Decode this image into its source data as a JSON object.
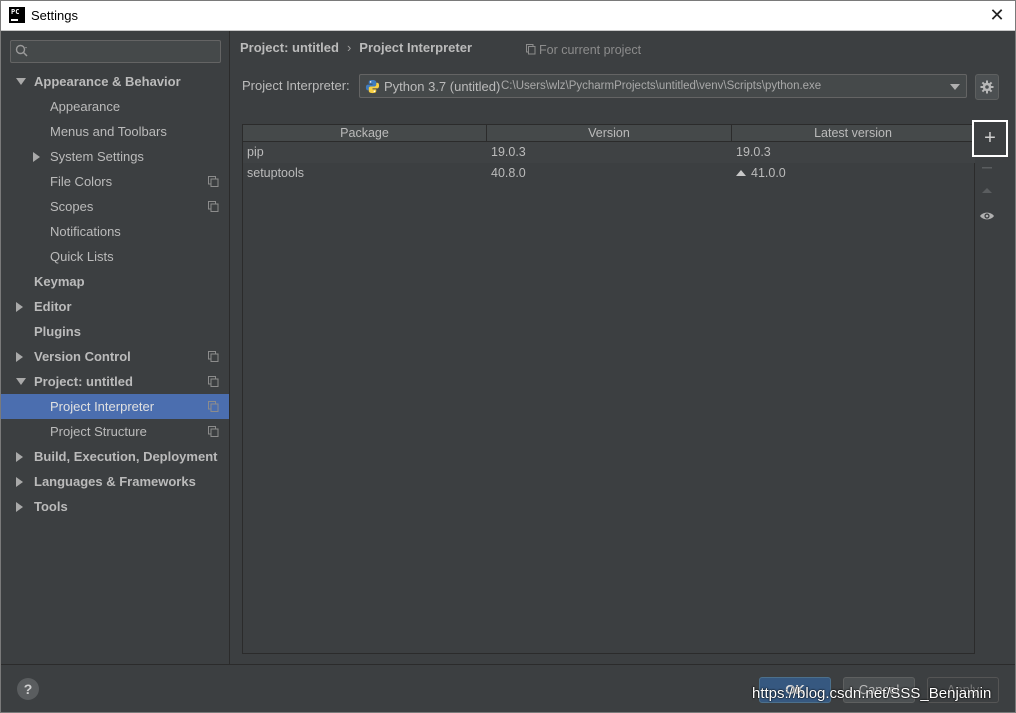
{
  "window": {
    "title": "Settings",
    "app_logo_text": "PC"
  },
  "search": {
    "placeholder": "",
    "value": ""
  },
  "sidebar": {
    "items": [
      {
        "label": "Appearance & Behavior",
        "level": 0,
        "bold": true,
        "arrow": "down",
        "project_icon": false,
        "selected": false
      },
      {
        "label": "Appearance",
        "level": 1,
        "bold": false,
        "arrow": "",
        "project_icon": false,
        "selected": false
      },
      {
        "label": "Menus and Toolbars",
        "level": 1,
        "bold": false,
        "arrow": "",
        "project_icon": false,
        "selected": false
      },
      {
        "label": "System Settings",
        "level": 1,
        "bold": false,
        "arrow": "right",
        "project_icon": false,
        "selected": false
      },
      {
        "label": "File Colors",
        "level": 1,
        "bold": false,
        "arrow": "",
        "project_icon": true,
        "selected": false
      },
      {
        "label": "Scopes",
        "level": 1,
        "bold": false,
        "arrow": "",
        "project_icon": true,
        "selected": false
      },
      {
        "label": "Notifications",
        "level": 1,
        "bold": false,
        "arrow": "",
        "project_icon": false,
        "selected": false
      },
      {
        "label": "Quick Lists",
        "level": 1,
        "bold": false,
        "arrow": "",
        "project_icon": false,
        "selected": false
      },
      {
        "label": "Keymap",
        "level": 0,
        "bold": true,
        "arrow": "",
        "project_icon": false,
        "selected": false
      },
      {
        "label": "Editor",
        "level": 0,
        "bold": true,
        "arrow": "right",
        "project_icon": false,
        "selected": false
      },
      {
        "label": "Plugins",
        "level": 0,
        "bold": true,
        "arrow": "",
        "project_icon": false,
        "selected": false
      },
      {
        "label": "Version Control",
        "level": 0,
        "bold": true,
        "arrow": "right",
        "project_icon": true,
        "selected": false
      },
      {
        "label": "Project: untitled",
        "level": 0,
        "bold": true,
        "arrow": "down",
        "project_icon": true,
        "selected": false
      },
      {
        "label": "Project Interpreter",
        "level": 1,
        "bold": false,
        "arrow": "",
        "project_icon": true,
        "selected": true
      },
      {
        "label": "Project Structure",
        "level": 1,
        "bold": false,
        "arrow": "",
        "project_icon": true,
        "selected": false
      },
      {
        "label": "Build, Execution, Deployment",
        "level": 0,
        "bold": true,
        "arrow": "right",
        "project_icon": false,
        "selected": false
      },
      {
        "label": "Languages & Frameworks",
        "level": 0,
        "bold": true,
        "arrow": "right",
        "project_icon": false,
        "selected": false
      },
      {
        "label": "Tools",
        "level": 0,
        "bold": true,
        "arrow": "right",
        "project_icon": false,
        "selected": false
      }
    ]
  },
  "breadcrumb": {
    "parent": "Project: untitled",
    "separator": "›",
    "current": "Project Interpreter"
  },
  "scope_note": "For current project",
  "interpreter": {
    "label": "Project Interpreter:",
    "name": "Python 3.7 (untitled)",
    "path": "C:\\Users\\wlz\\PycharmProjects\\untitled\\venv\\Scripts\\python.exe"
  },
  "packages_table": {
    "columns": [
      "Package",
      "Version",
      "Latest version"
    ],
    "rows": [
      {
        "package": "pip",
        "version": "19.0.3",
        "latest": "19.0.3",
        "upgrade": false
      },
      {
        "package": "setuptools",
        "version": "40.8.0",
        "latest": "41.0.0",
        "upgrade": true
      }
    ]
  },
  "footer": {
    "help_label": "?",
    "ok_label": "OK",
    "cancel_label": "Cancel",
    "apply_label": "Apply",
    "watermark": "https://blog.csdn.net/SSS_Benjamin"
  },
  "colors": {
    "selection": "#4b6eaf",
    "background": "#3c3f41",
    "ok_button": "#365880"
  }
}
